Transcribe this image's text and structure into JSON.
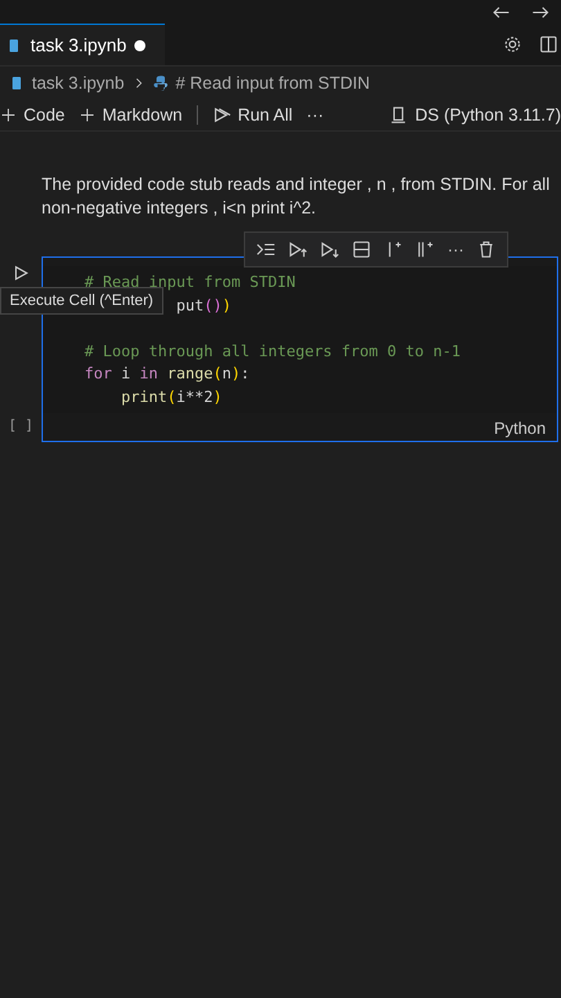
{
  "tab": {
    "label": "task 3.ipynb",
    "modified": true
  },
  "breadcrumb": {
    "file": "task 3.ipynb",
    "cell": "# Read input from STDIN"
  },
  "toolbar": {
    "items": [
      "Code",
      "Markdown",
      "Run All",
      "···"
    ],
    "kernel": "DS (Python 3.11.7)"
  },
  "markdown": "The provided code stub reads and integer , n , from STDIN. For all non-negative integers , i<n print i^2.",
  "cell": {
    "tooltip": "Execute Cell (^Enter)",
    "exec_count": "[ ]",
    "language": "Python",
    "more": "···",
    "lines": [
      {
        "kind": "code",
        "tokens": [
          {
            "kind": "comment",
            "text": "# Read input from STDIN"
          }
        ]
      },
      {
        "kind": "covered",
        "tokens": [
          {
            "kind": "plain",
            "text": "put"
          },
          {
            "kind": "paren",
            "text": "()"
          },
          {
            "kind": "paren2",
            "text": ")"
          }
        ]
      },
      {
        "kind": "blank"
      },
      {
        "kind": "code",
        "tokens": [
          {
            "kind": "comment",
            "text": "# Loop through all integers from 0 to n-1"
          }
        ]
      },
      {
        "kind": "code",
        "tokens": [
          {
            "kind": "keyword",
            "text": "for"
          },
          {
            "kind": "plain",
            "text": " i "
          },
          {
            "kind": "keyword",
            "text": "in"
          },
          {
            "kind": "func",
            "text": " range"
          },
          {
            "kind": "paren2",
            "text": "("
          },
          {
            "kind": "plain",
            "text": "n"
          },
          {
            "kind": "paren2",
            "text": ")"
          },
          {
            "kind": "plain",
            "text": ":"
          }
        ]
      },
      {
        "kind": "indented",
        "tokens": [
          {
            "kind": "func",
            "text": "print"
          },
          {
            "kind": "paren2",
            "text": "("
          },
          {
            "kind": "plain",
            "text": "i**2"
          },
          {
            "kind": "paren2",
            "text": ")"
          }
        ]
      }
    ]
  }
}
